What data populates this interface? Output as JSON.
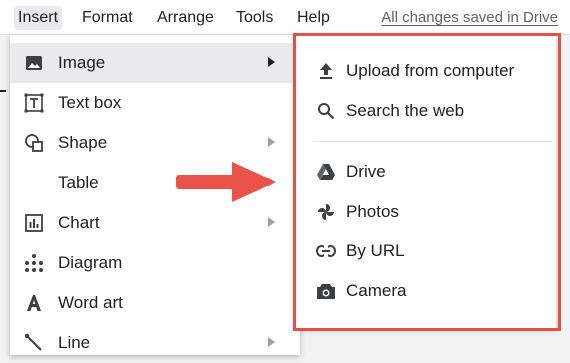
{
  "menubar": {
    "items": [
      "Insert",
      "Format",
      "Arrange",
      "Tools",
      "Help"
    ],
    "saved_status": "All changes saved in Drive"
  },
  "insert_menu": {
    "items": [
      {
        "label": "Image",
        "icon": "image-icon",
        "submenu": true,
        "highlighted": true
      },
      {
        "label": "Text box",
        "icon": "text-box-icon",
        "submenu": false
      },
      {
        "label": "Shape",
        "icon": "shape-icon",
        "submenu": true
      },
      {
        "label": "Table",
        "icon": "",
        "submenu": true
      },
      {
        "label": "Chart",
        "icon": "chart-icon",
        "submenu": true
      },
      {
        "label": "Diagram",
        "icon": "diagram-icon",
        "submenu": false
      },
      {
        "label": "Word art",
        "icon": "word-art-icon",
        "submenu": false
      },
      {
        "label": "Line",
        "icon": "line-icon",
        "submenu": true
      }
    ]
  },
  "image_submenu": {
    "items": [
      {
        "label": "Upload from computer",
        "icon": "upload-icon"
      },
      {
        "label": "Search the web",
        "icon": "search-icon"
      },
      {
        "label": "Drive",
        "icon": "drive-icon"
      },
      {
        "label": "Photos",
        "icon": "photos-icon"
      },
      {
        "label": "By URL",
        "icon": "link-icon"
      },
      {
        "label": "Camera",
        "icon": "camera-icon"
      }
    ]
  },
  "colors": {
    "highlight_frame": "#e2514a",
    "arrow": "#e9534a",
    "menu_highlight": "#e8eaed"
  }
}
